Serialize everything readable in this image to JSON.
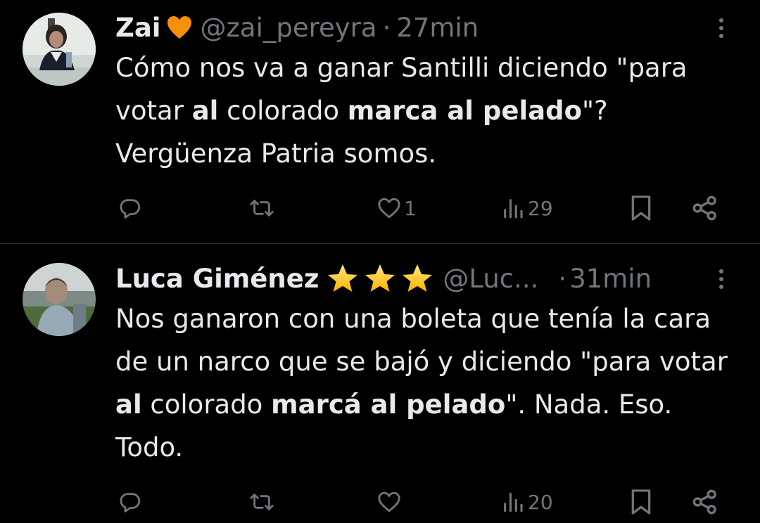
{
  "colors": {
    "background": "#000000",
    "primary_text": "#e7e9ea",
    "secondary_text": "#71767b",
    "divider": "#2f3336"
  },
  "tweets": [
    {
      "display_name": "Zai",
      "name_emoji": "orange-heart",
      "handle": "@zai_pereyra",
      "separator": "·",
      "time": "27min",
      "text": [
        {
          "t": "Cómo nos va a ganar Santilli diciendo \"para votar ",
          "bold": false
        },
        {
          "t": "al",
          "bold": true
        },
        {
          "t": " colorado ",
          "bold": false
        },
        {
          "t": "marca al pelado",
          "bold": true
        },
        {
          "t": "\"? Vergüenza Patria somos.",
          "bold": false
        }
      ],
      "actions": {
        "reply": "",
        "retweet": "",
        "like": "1",
        "views": "29"
      }
    },
    {
      "display_name": "Luca Giménez",
      "name_emoji": "three-stars",
      "handle": "@Luc...",
      "separator": "·",
      "time": "31min",
      "text": [
        {
          "t": "Nos ganaron con una boleta que tenía la cara de un narco que se bajó y diciendo \"para votar ",
          "bold": false
        },
        {
          "t": "al",
          "bold": true
        },
        {
          "t": " colorado ",
          "bold": false
        },
        {
          "t": "marcá al pelado",
          "bold": true
        },
        {
          "t": "\". Nada. Eso. Todo.",
          "bold": false
        }
      ],
      "actions": {
        "reply": "",
        "retweet": "",
        "like": "",
        "views": "20"
      }
    }
  ]
}
